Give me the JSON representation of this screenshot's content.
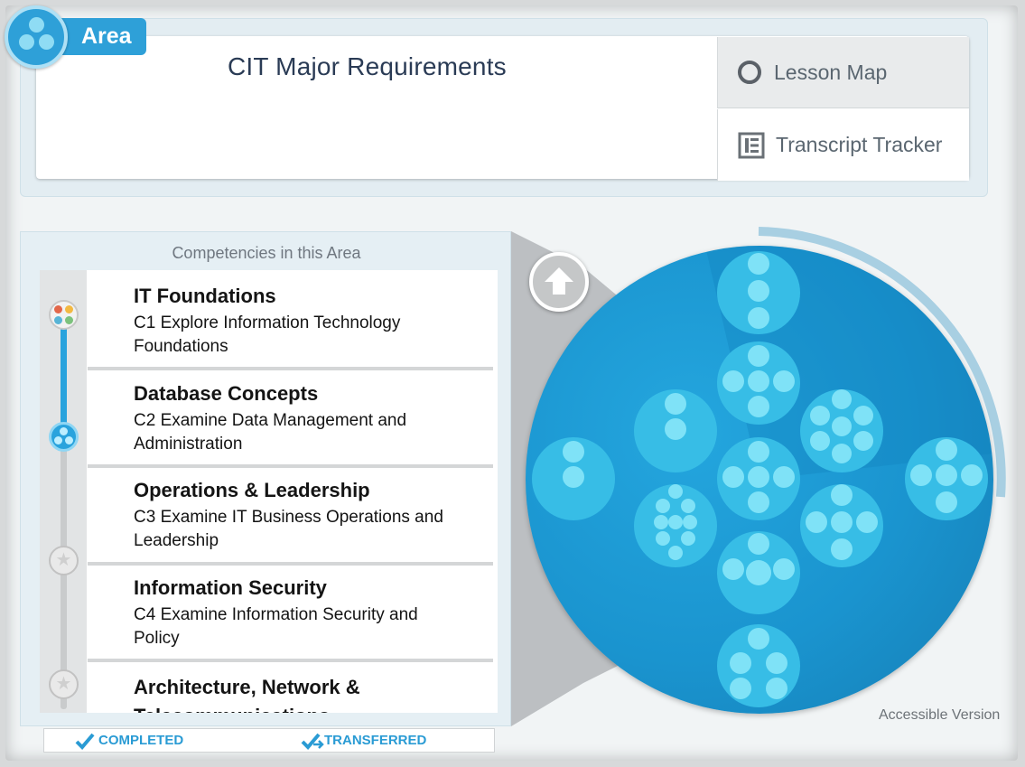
{
  "header": {
    "area_label": "Area",
    "title": "CIT Major Requirements",
    "nav": {
      "lesson_map": "Lesson Map",
      "transcript_tracker": "Transcript Tracker"
    }
  },
  "competencies": {
    "heading": "Competencies in this Area",
    "items": [
      {
        "title": "IT Foundations",
        "desc": "C1 Explore Information Technology Foundations"
      },
      {
        "title": "Database Concepts",
        "desc": "C2 Examine Data Management and Administration"
      },
      {
        "title": "Operations & Leadership",
        "desc": "C3 Examine IT Business Operations and Leadership"
      },
      {
        "title": "Information Security",
        "desc": "C4 Examine Information Security and Policy"
      },
      {
        "title": "Architecture, Network & Telecommunications",
        "desc": ""
      }
    ]
  },
  "legend": {
    "completed": "COMPLETED",
    "transferred": "TRANSFERRED"
  },
  "map": {
    "accessible_link": "Accessible Version"
  },
  "icons": {
    "area": "area-badge-icon",
    "lesson_map": "ring-icon",
    "transcript": "transcript-icon",
    "up": "up-arrow-icon",
    "check": "check-icon"
  },
  "colors": {
    "accent": "#2ea0d8",
    "map_blue": "#1a94cf",
    "cluster_light": "#7fdaf2"
  }
}
